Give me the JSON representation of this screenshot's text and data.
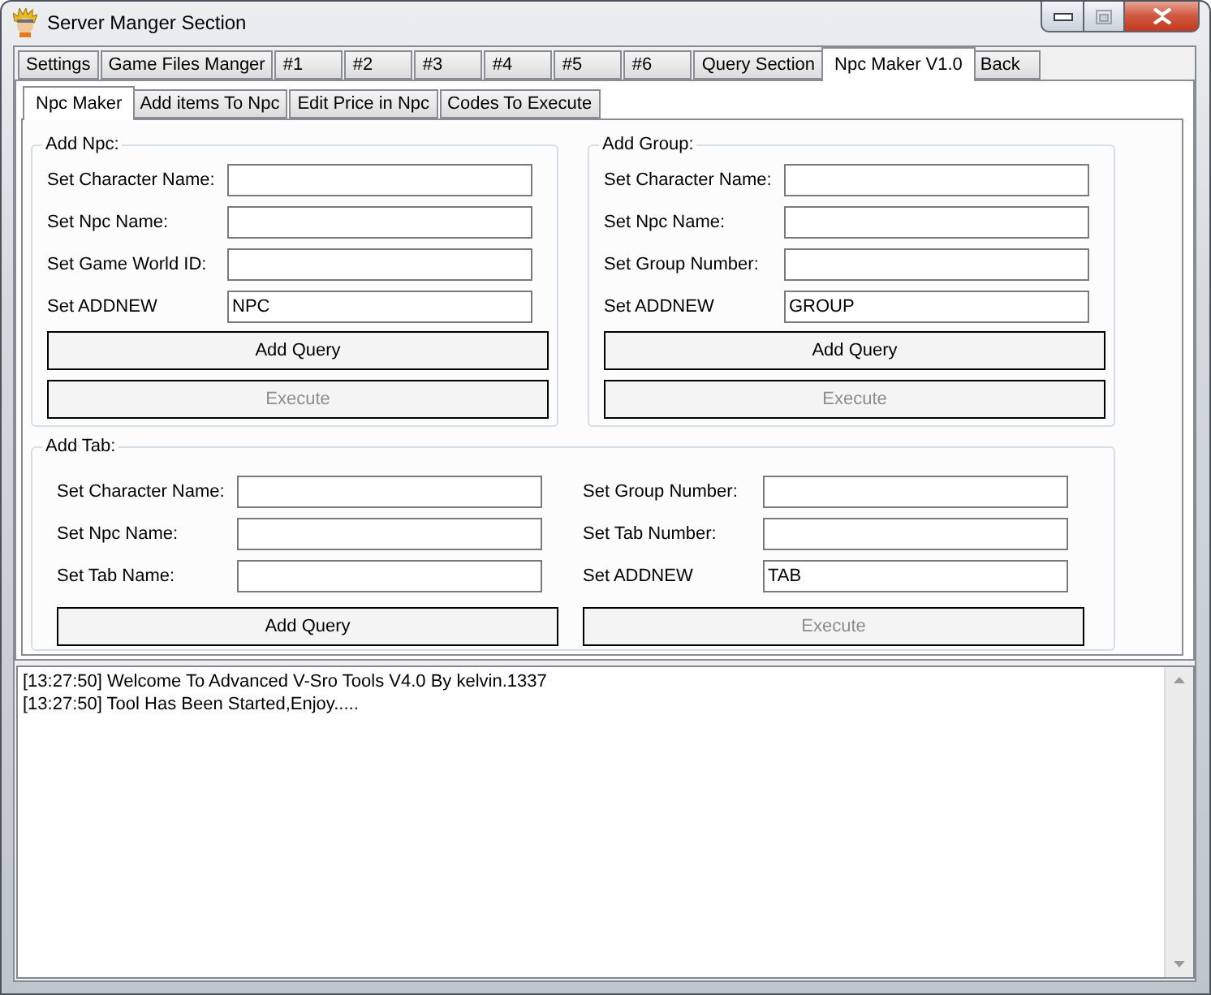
{
  "window": {
    "title": "Server Manger Section"
  },
  "main_tabs": [
    {
      "label": "Settings",
      "selected": false
    },
    {
      "label": "Game Files Manger",
      "selected": false
    },
    {
      "label": "#1",
      "selected": false
    },
    {
      "label": "#2",
      "selected": false
    },
    {
      "label": "#3",
      "selected": false
    },
    {
      "label": "#4",
      "selected": false
    },
    {
      "label": "#5",
      "selected": false
    },
    {
      "label": "#6",
      "selected": false
    },
    {
      "label": "Query Section",
      "selected": false
    },
    {
      "label": "Npc Maker V1.0",
      "selected": true
    },
    {
      "label": "Back",
      "selected": false
    }
  ],
  "sub_tabs": [
    {
      "label": "Npc Maker",
      "selected": true
    },
    {
      "label": "Add items To Npc",
      "selected": false
    },
    {
      "label": "Edit Price in Npc",
      "selected": false
    },
    {
      "label": "Codes To Execute",
      "selected": false
    }
  ],
  "groups": [
    {
      "kind": "single",
      "title": "Add Npc:",
      "columns": [
        {
          "fields": [
            {
              "label": "Set Character Name:"
            },
            {
              "label": "Set Npc Name:"
            },
            {
              "label": "Set Game World ID:"
            },
            {
              "label": "Set ADDNEW",
              "value": "NPC"
            }
          ],
          "buttons": [
            {
              "label": "Add Query",
              "disabled": false
            },
            {
              "label": "Execute",
              "disabled": true
            }
          ]
        }
      ]
    },
    {
      "kind": "single",
      "title": "Add Group:",
      "columns": [
        {
          "fields": [
            {
              "label": "Set Character Name:"
            },
            {
              "label": "Set Npc Name:"
            },
            {
              "label": "Set Group Number:"
            },
            {
              "label": "Set ADDNEW",
              "value": "GROUP"
            }
          ],
          "buttons": [
            {
              "label": "Add Query",
              "disabled": false
            },
            {
              "label": "Execute",
              "disabled": true
            }
          ]
        }
      ]
    },
    {
      "kind": "wide",
      "title": "Add Tab:",
      "columns": [
        {
          "fields": [
            {
              "label": "Set Character Name:"
            },
            {
              "label": "Set Npc Name:"
            },
            {
              "label": "Set Tab Name:"
            }
          ],
          "buttons": [
            {
              "label": "Add Query",
              "disabled": false
            }
          ]
        },
        {
          "fields": [
            {
              "label": "Set Group Number:"
            },
            {
              "label": "Set Tab Number:"
            },
            {
              "label": "Set ADDNEW",
              "value": "TAB"
            }
          ],
          "buttons": [
            {
              "label": "Execute",
              "disabled": true
            }
          ]
        }
      ]
    }
  ],
  "log": {
    "lines": [
      "[13:27:50] Welcome To Advanced V-Sro Tools V4.0 By kelvin.1337",
      "[13:27:50] Tool Has Been Started,Enjoy....."
    ]
  }
}
